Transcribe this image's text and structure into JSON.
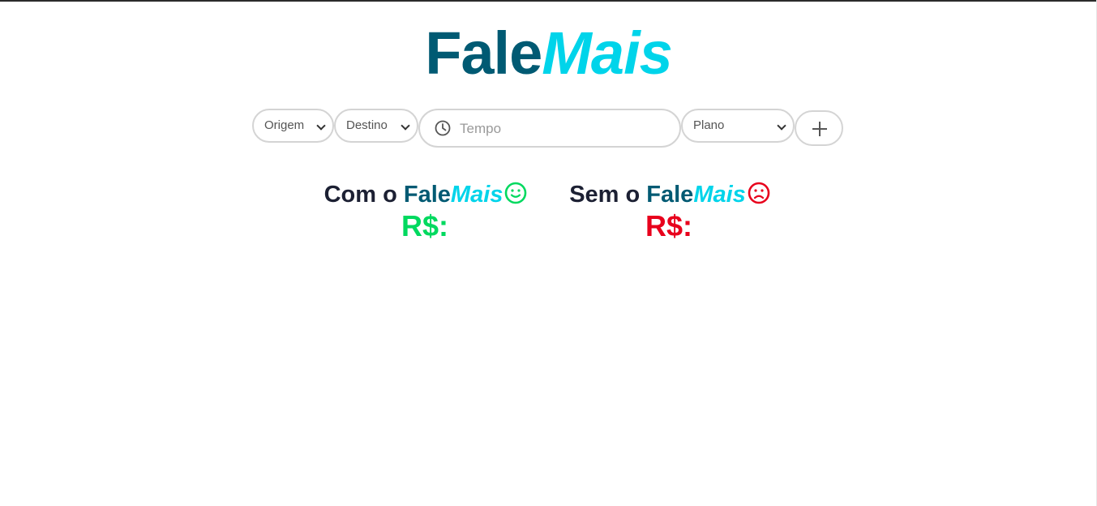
{
  "logo": {
    "part1": "Fale",
    "part2": "Mais"
  },
  "form": {
    "origem": "Origem",
    "destino": "Destino",
    "tempo_placeholder": "Tempo",
    "plano": "Plano",
    "add_icon": "plus-icon",
    "time_icon": "clock-icon"
  },
  "results": {
    "with": {
      "prefix": "Com o ",
      "brand1": "Fale",
      "brand2": "Mais",
      "icon": "smile-icon",
      "price": "R$:"
    },
    "without": {
      "prefix": "Sem o ",
      "brand1": "Fale",
      "brand2": "Mais",
      "icon": "frown-icon",
      "price": "R$:"
    }
  },
  "colors": {
    "brand_dark": "#005a73",
    "brand_light": "#00d4ea",
    "positive": "#00d95f",
    "negative": "#e8001c"
  }
}
